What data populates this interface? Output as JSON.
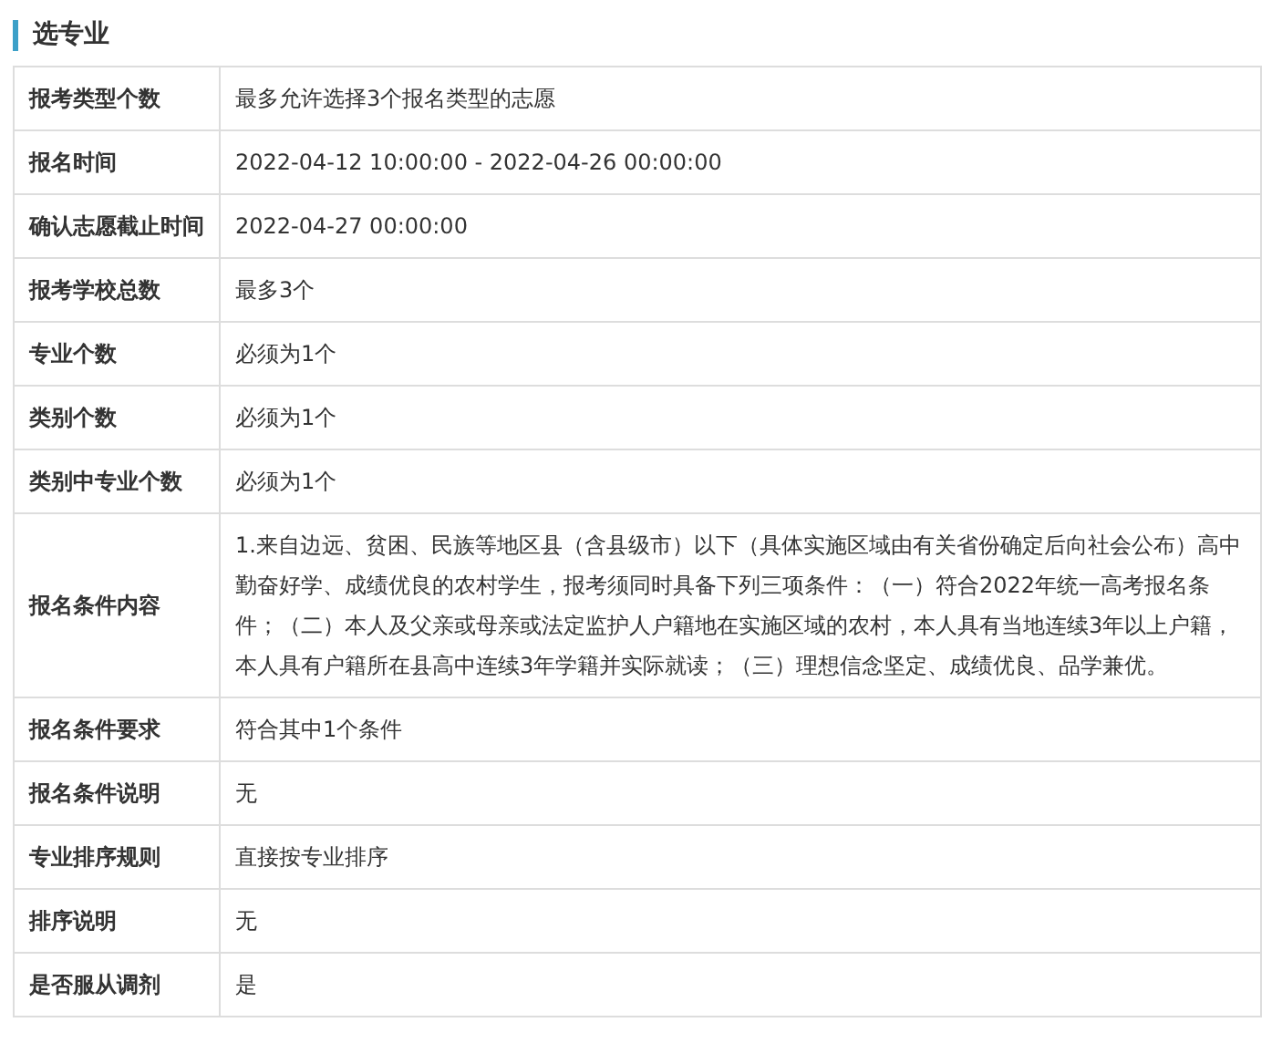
{
  "section_title": "选专业",
  "rows": [
    {
      "label": "报考类型个数",
      "value": "最多允许选择3个报名类型的志愿"
    },
    {
      "label": "报名时间",
      "value": "2022-04-12 10:00:00 - 2022-04-26 00:00:00"
    },
    {
      "label": "确认志愿截止时间",
      "value": "2022-04-27 00:00:00"
    },
    {
      "label": "报考学校总数",
      "value": "最多3个"
    },
    {
      "label": "专业个数",
      "value": "必须为1个"
    },
    {
      "label": "类别个数",
      "value": "必须为1个"
    },
    {
      "label": "类别中专业个数",
      "value": "必须为1个"
    },
    {
      "label": "报名条件内容",
      "value": "1.来自边远、贫困、民族等地区县（含县级市）以下（具体实施区域由有关省份确定后向社会公布）高中勤奋好学、成绩优良的农村学生，报考须同时具备下列三项条件：（一）符合2022年统一高考报名条件；（二）本人及父亲或母亲或法定监护人户籍地在实施区域的农村，本人具有当地连续3年以上户籍，本人具有户籍所在县高中连续3年学籍并实际就读；（三）理想信念坚定、成绩优良、品学兼优。"
    },
    {
      "label": "报名条件要求",
      "value": "符合其中1个条件"
    },
    {
      "label": "报名条件说明",
      "value": "无"
    },
    {
      "label": "专业排序规则",
      "value": "直接按专业排序"
    },
    {
      "label": "排序说明",
      "value": "无"
    },
    {
      "label": "是否服从调剂",
      "value": "是"
    }
  ]
}
